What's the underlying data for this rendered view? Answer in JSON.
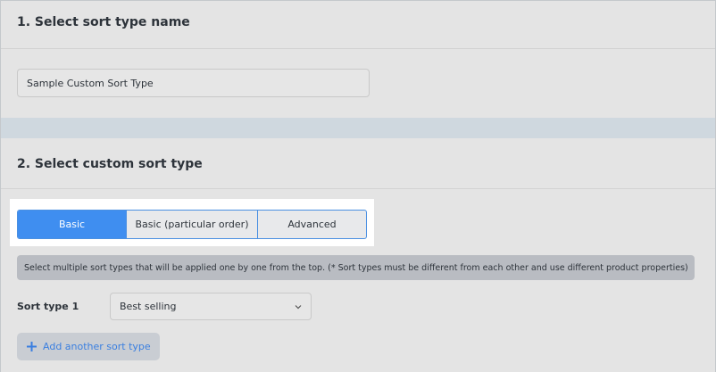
{
  "section1": {
    "title": "1. Select sort type name",
    "name_input_value": "Sample Custom Sort Type"
  },
  "section2": {
    "title": "2. Select custom sort type",
    "tabs": [
      {
        "label": "Basic",
        "selected": true
      },
      {
        "label": "Basic (particular order)",
        "selected": false
      },
      {
        "label": "Advanced",
        "selected": false
      }
    ],
    "info_note": "Select multiple sort types that will be applied one by one from the top. (* Sort types must be different from each other and use different product properties)",
    "sort_rows": [
      {
        "label": "Sort type 1",
        "selected_value": "Best selling"
      }
    ],
    "add_button_label": "Add another sort type"
  },
  "colors": {
    "accent": "#3f8ef0",
    "link": "#3a7fe0",
    "panel": "#e4e4e4",
    "gutter": "#cfd8df"
  },
  "icons": {
    "select_chevron": "chevron-down-icon",
    "add": "plus-icon"
  }
}
